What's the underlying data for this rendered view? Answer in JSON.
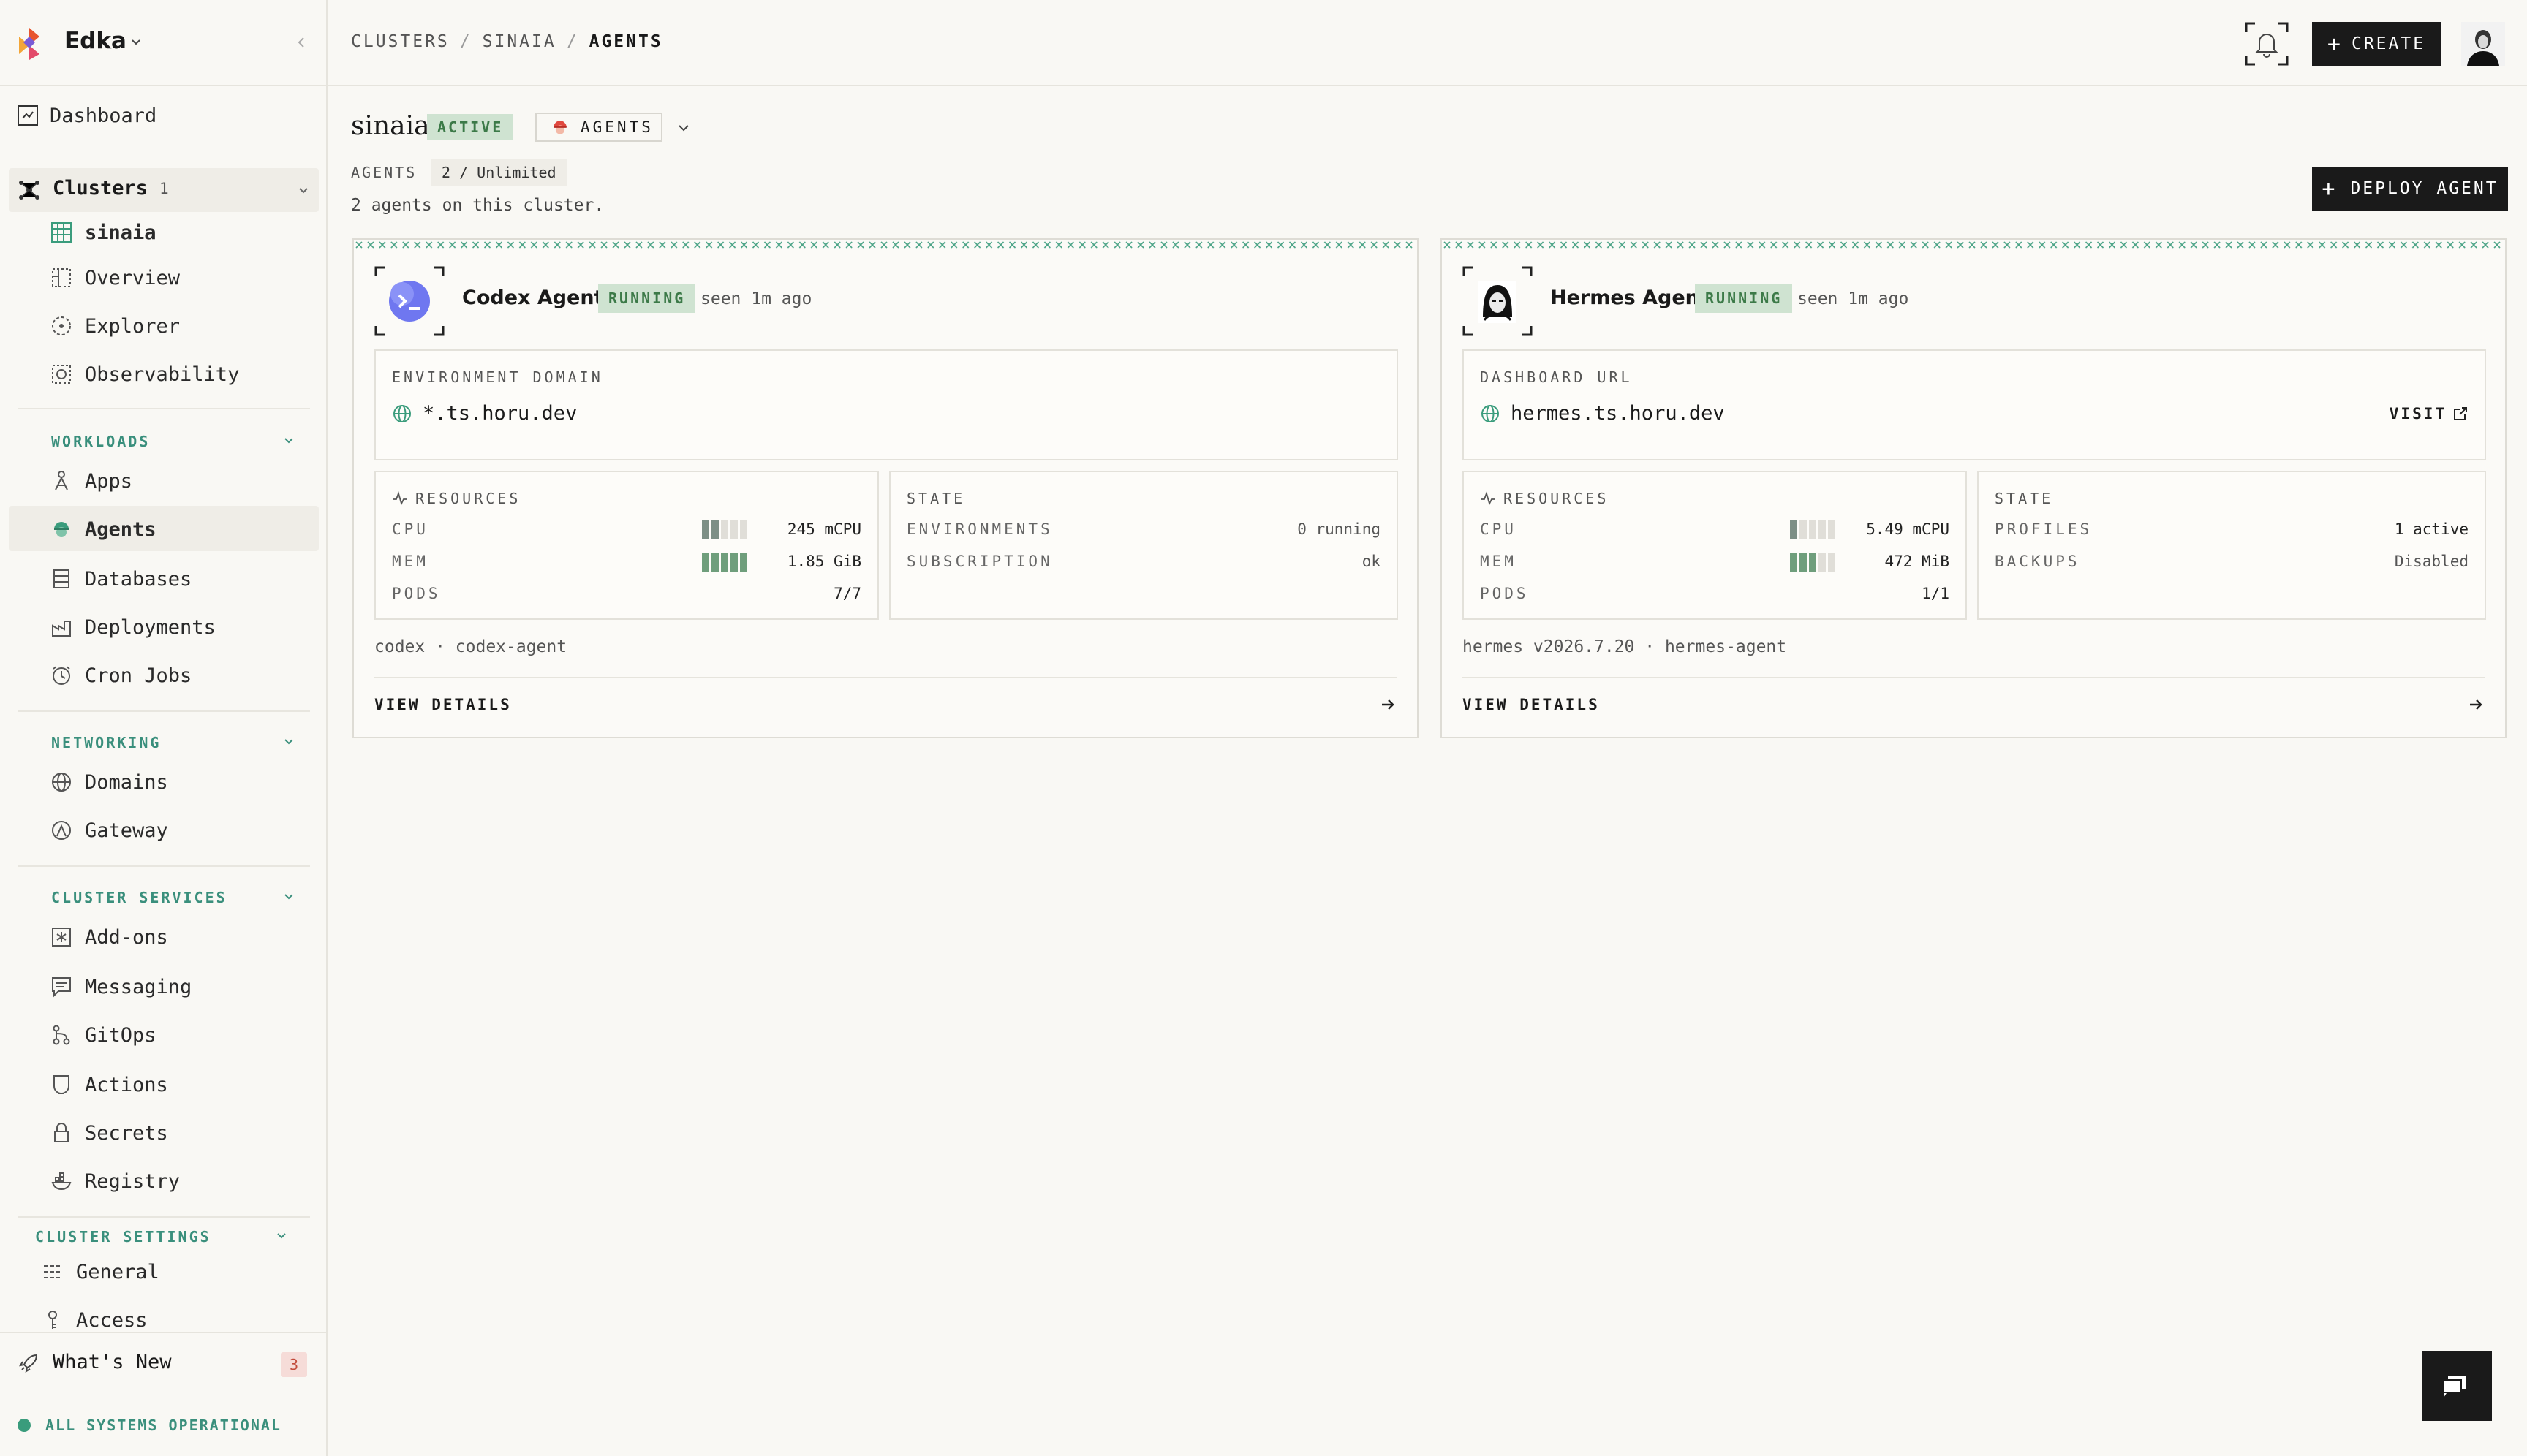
{
  "sidebar": {
    "workspace_name": "Edka",
    "dashboard": "Dashboard",
    "clusters": {
      "label": "Clusters",
      "count": "1",
      "current": "sinaia",
      "items": [
        {
          "label": "Overview"
        },
        {
          "label": "Explorer"
        },
        {
          "label": "Observability"
        }
      ]
    },
    "workloads": {
      "title": "WORKLOADS",
      "items": [
        {
          "label": "Apps"
        },
        {
          "label": "Agents"
        },
        {
          "label": "Databases"
        },
        {
          "label": "Deployments"
        },
        {
          "label": "Cron Jobs"
        }
      ]
    },
    "networking": {
      "title": "NETWORKING",
      "items": [
        {
          "label": "Domains"
        },
        {
          "label": "Gateway"
        }
      ]
    },
    "cluster_services": {
      "title": "CLUSTER SERVICES",
      "items": [
        {
          "label": "Add-ons"
        },
        {
          "label": "Messaging"
        },
        {
          "label": "GitOps"
        },
        {
          "label": "Actions"
        },
        {
          "label": "Secrets"
        },
        {
          "label": "Registry"
        }
      ]
    },
    "cluster_settings": {
      "title": "CLUSTER SETTINGS",
      "items": [
        {
          "label": "General"
        },
        {
          "label": "Access"
        }
      ]
    },
    "whats_new": {
      "label": "What's New",
      "badge": "3"
    },
    "status": "ALL SYSTEMS OPERATIONAL"
  },
  "topbar": {
    "breadcrumbs": [
      "CLUSTERS",
      "SINAIA",
      "AGENTS"
    ],
    "create_label": "CREATE"
  },
  "page": {
    "cluster_name": "sinaia",
    "status": "ACTIVE",
    "section_dropdown": "AGENTS",
    "agents_label": "AGENTS",
    "agents_count": "2 / Unlimited",
    "description": "2 agents on this cluster.",
    "deploy_label": "DEPLOY AGENT"
  },
  "agents": [
    {
      "name": "Codex Agent",
      "status": "RUNNING",
      "seen": "seen 1m ago",
      "endpoint_label": "ENVIRONMENT DOMAIN",
      "endpoint": "*.ts.horu.dev",
      "resources_title": "RESOURCES",
      "cpu_label": "CPU",
      "cpu": "245 mCPU",
      "cpu_level": 2,
      "mem_label": "MEM",
      "mem": "1.85 GiB",
      "mem_level": 5,
      "pods_label": "PODS",
      "pods": "7/7",
      "state_title": "STATE",
      "state": [
        {
          "k": "ENVIRONMENTS",
          "v": "0 running"
        },
        {
          "k": "SUBSCRIPTION",
          "v": "ok"
        }
      ],
      "tags": "codex · codex-agent",
      "details_label": "VIEW DETAILS"
    },
    {
      "name": "Hermes Agent",
      "status": "RUNNING",
      "seen": "seen 1m ago",
      "endpoint_label": "DASHBOARD URL",
      "endpoint": "hermes.ts.horu.dev",
      "visit_label": "VISIT",
      "resources_title": "RESOURCES",
      "cpu_label": "CPU",
      "cpu": "5.49 mCPU",
      "cpu_level": 1,
      "mem_label": "MEM",
      "mem": "472 MiB",
      "mem_level": 3,
      "pods_label": "PODS",
      "pods": "1/1",
      "state_title": "STATE",
      "state": [
        {
          "k": "PROFILES",
          "v": "1 active"
        },
        {
          "k": "BACKUPS",
          "v": "Disabled"
        }
      ],
      "tags": "hermes v2026.7.20 · hermes-agent",
      "details_label": "VIEW DETAILS"
    }
  ],
  "colors": {
    "accent_green": "#3a8f7c",
    "running_bg": "#cfe3d1",
    "running_fg": "#3c7a48",
    "bar_fill": "#7d8f86",
    "bar_mem": "#6f9e7c"
  }
}
